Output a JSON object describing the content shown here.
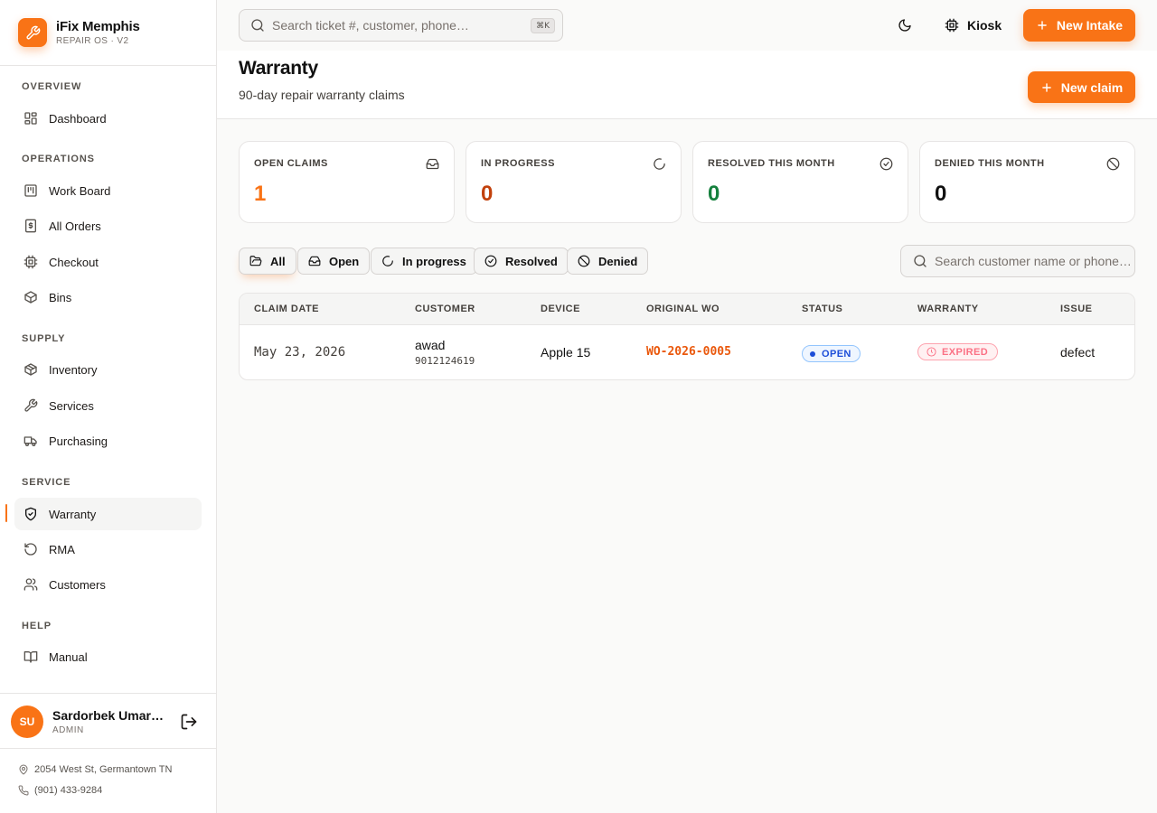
{
  "brand": {
    "name": "iFix Memphis",
    "subtitle": "REPAIR OS · V2"
  },
  "sidebar": {
    "sections": {
      "overview": "OVERVIEW",
      "operations": "OPERATIONS",
      "supply": "SUPPLY",
      "service": "SERVICE",
      "help": "HELP"
    },
    "items": {
      "dashboard": "Dashboard",
      "work_board": "Work Board",
      "all_orders": "All Orders",
      "checkout": "Checkout",
      "bins": "Bins",
      "inventory": "Inventory",
      "services": "Services",
      "purchasing": "Purchasing",
      "warranty": "Warranty",
      "rma": "RMA",
      "customers": "Customers",
      "manual": "Manual"
    },
    "active_item": "Warranty"
  },
  "user": {
    "initials": "SU",
    "name": "Sardorbek Umarov",
    "role": "ADMIN"
  },
  "contact": {
    "address": "2054 West St, Germantown TN",
    "phone": "(901) 433-9284"
  },
  "topbar": {
    "search_placeholder": "Search ticket #, customer, phone…",
    "shortcut": "⌘K",
    "kiosk_label": "Kiosk",
    "new_intake_label": "New Intake"
  },
  "page": {
    "title": "Warranty",
    "subtitle": "90-day repair warranty claims",
    "new_claim_label": "New claim"
  },
  "stats": [
    {
      "label": "OPEN CLAIMS",
      "value": "1",
      "color": "#f97316",
      "icon": "inbox-icon"
    },
    {
      "label": "IN PROGRESS",
      "value": "0",
      "color": "#c2410c",
      "icon": "spinner-icon"
    },
    {
      "label": "RESOLVED THIS MONTH",
      "value": "0",
      "color": "#15803d",
      "icon": "check-circle-icon"
    },
    {
      "label": "DENIED THIS MONTH",
      "value": "0",
      "color": "#111111",
      "icon": "ban-icon"
    }
  ],
  "filters": {
    "all": "All",
    "open": "Open",
    "in_progress": "In progress",
    "resolved": "Resolved",
    "denied": "Denied",
    "active": "All"
  },
  "claims_search_placeholder": "Search customer name or phone…",
  "table": {
    "columns": [
      "CLAIM DATE",
      "CUSTOMER",
      "DEVICE",
      "ORIGINAL WO",
      "STATUS",
      "WARRANTY",
      "ISSUE"
    ],
    "rows": [
      {
        "claim_date": "May 23, 2026",
        "customer_name": "awad",
        "customer_phone": "9012124619",
        "device": "Apple 15",
        "original_wo": "WO-2026-0005",
        "status": "OPEN",
        "warranty": "EXPIRED",
        "issue": "defect"
      }
    ]
  },
  "colors": {
    "accent": "#f97316",
    "status_open": "#1d4ed8",
    "warranty_expired": "#fb7185",
    "wo_link": "#ea580c"
  }
}
